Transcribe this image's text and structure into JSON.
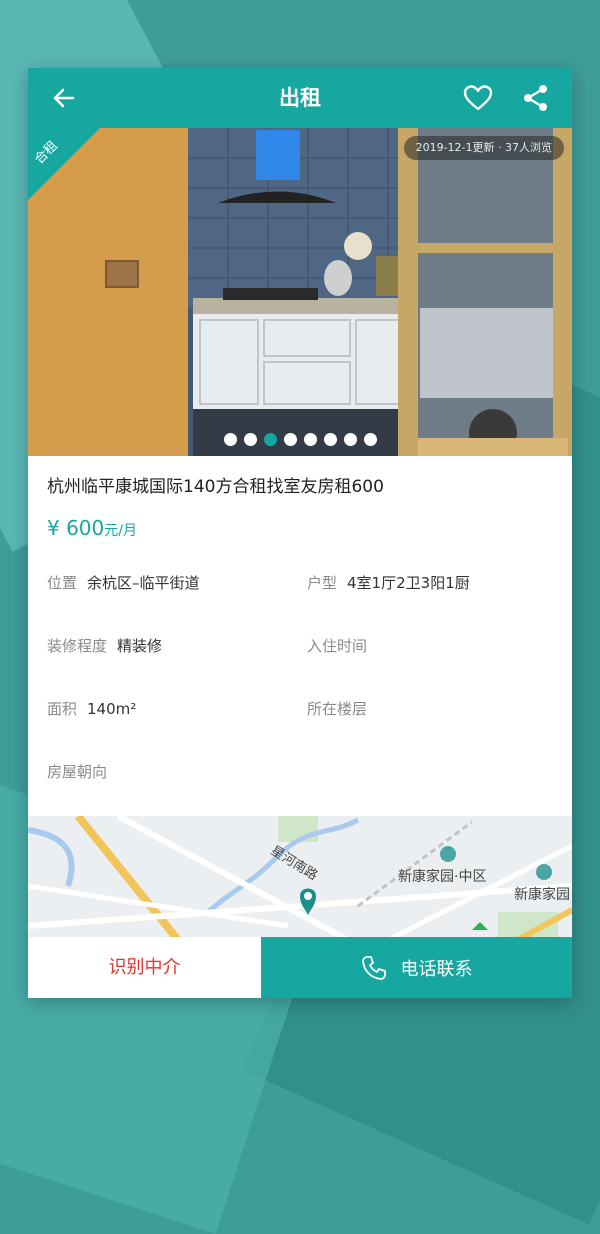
{
  "header": {
    "title": "出租"
  },
  "photo": {
    "badge": "合租",
    "update_info": "2019-12-1更新 · 37人浏览",
    "dot_count": 8,
    "active_index": 2
  },
  "listing": {
    "title": "杭州临平康城国际140方合租找室友房租600",
    "price_amount": "¥ 600",
    "price_unit": "元/月",
    "details": {
      "location_label": "位置",
      "location_value": "余杭区–临平街道",
      "layout_label": "户型",
      "layout_value": "4室1厅2卫3阳1厨",
      "decoration_label": "装修程度",
      "decoration_value": "精装修",
      "movein_label": "入住时间",
      "movein_value": "",
      "area_label": "面积",
      "area_value": "140m²",
      "floor_label": "所在楼层",
      "floor_value": "",
      "orientation_label": "房屋朝向",
      "orientation_value": ""
    }
  },
  "map": {
    "road_label": "星河南路",
    "poi_1": "新康家园·中区",
    "poi_2": "新康家园"
  },
  "bottom": {
    "agent_label": "识别中介",
    "call_label": "电话联系"
  },
  "colors": {
    "accent": "#17a7a1",
    "warning": "#e0332f"
  },
  "icons": [
    "back-arrow-icon",
    "heart-icon",
    "share-icon",
    "phone-icon",
    "map-pin-icon",
    "building-icon"
  ]
}
